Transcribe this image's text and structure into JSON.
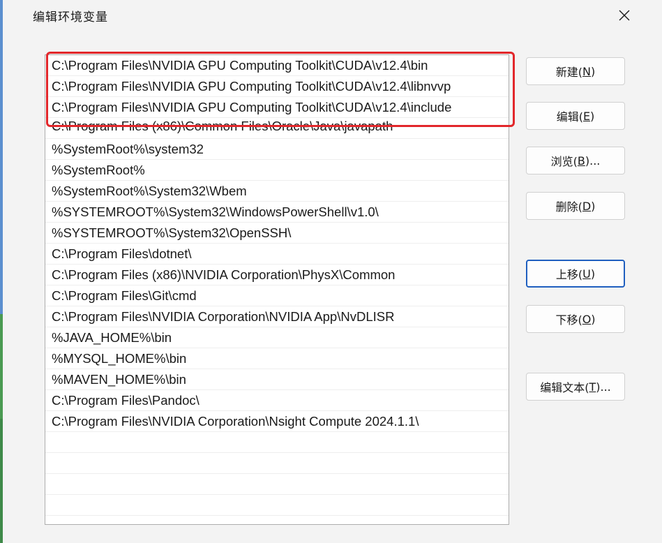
{
  "dialog": {
    "title": "编辑环境变量"
  },
  "path_list": {
    "items": [
      "C:\\Program Files\\NVIDIA GPU Computing Toolkit\\CUDA\\v12.4\\bin",
      "C:\\Program Files\\NVIDIA GPU Computing Toolkit\\CUDA\\v12.4\\libnvvp",
      "C:\\Program Files\\NVIDIA GPU Computing Toolkit\\CUDA\\v12.4\\include",
      "C:\\Program Files (x86)\\Common Files\\Oracle\\Java\\javapath",
      "%SystemRoot%\\system32",
      "%SystemRoot%",
      "%SystemRoot%\\System32\\Wbem",
      "%SYSTEMROOT%\\System32\\WindowsPowerShell\\v1.0\\",
      "%SYSTEMROOT%\\System32\\OpenSSH\\",
      "C:\\Program Files\\dotnet\\",
      "C:\\Program Files (x86)\\NVIDIA Corporation\\PhysX\\Common",
      "C:\\Program Files\\Git\\cmd",
      "C:\\Program Files\\NVIDIA Corporation\\NVIDIA App\\NvDLISR",
      "%JAVA_HOME%\\bin",
      "%MYSQL_HOME%\\bin",
      "%MAVEN_HOME%\\bin",
      "C:\\Program Files\\Pandoc\\",
      "C:\\Program Files\\NVIDIA Corporation\\Nsight Compute 2024.1.1\\"
    ]
  },
  "buttons": {
    "new": {
      "label": "新建(",
      "key": "N",
      "end": ")"
    },
    "edit": {
      "label": "编辑(",
      "key": "E",
      "end": ")"
    },
    "browse": {
      "label": "浏览(",
      "key": "B",
      "end": ")..."
    },
    "delete": {
      "label": "删除(",
      "key": "D",
      "end": ")"
    },
    "move_up": {
      "label": "上移(",
      "key": "U",
      "end": ")"
    },
    "move_down": {
      "label": "下移(",
      "key": "O",
      "end": ")"
    },
    "edit_text": {
      "label": "编辑文本(",
      "key": "T",
      "end": ")..."
    }
  },
  "colors": {
    "highlight_box": "#e2272b",
    "focus_border": "#1f5fbf"
  }
}
